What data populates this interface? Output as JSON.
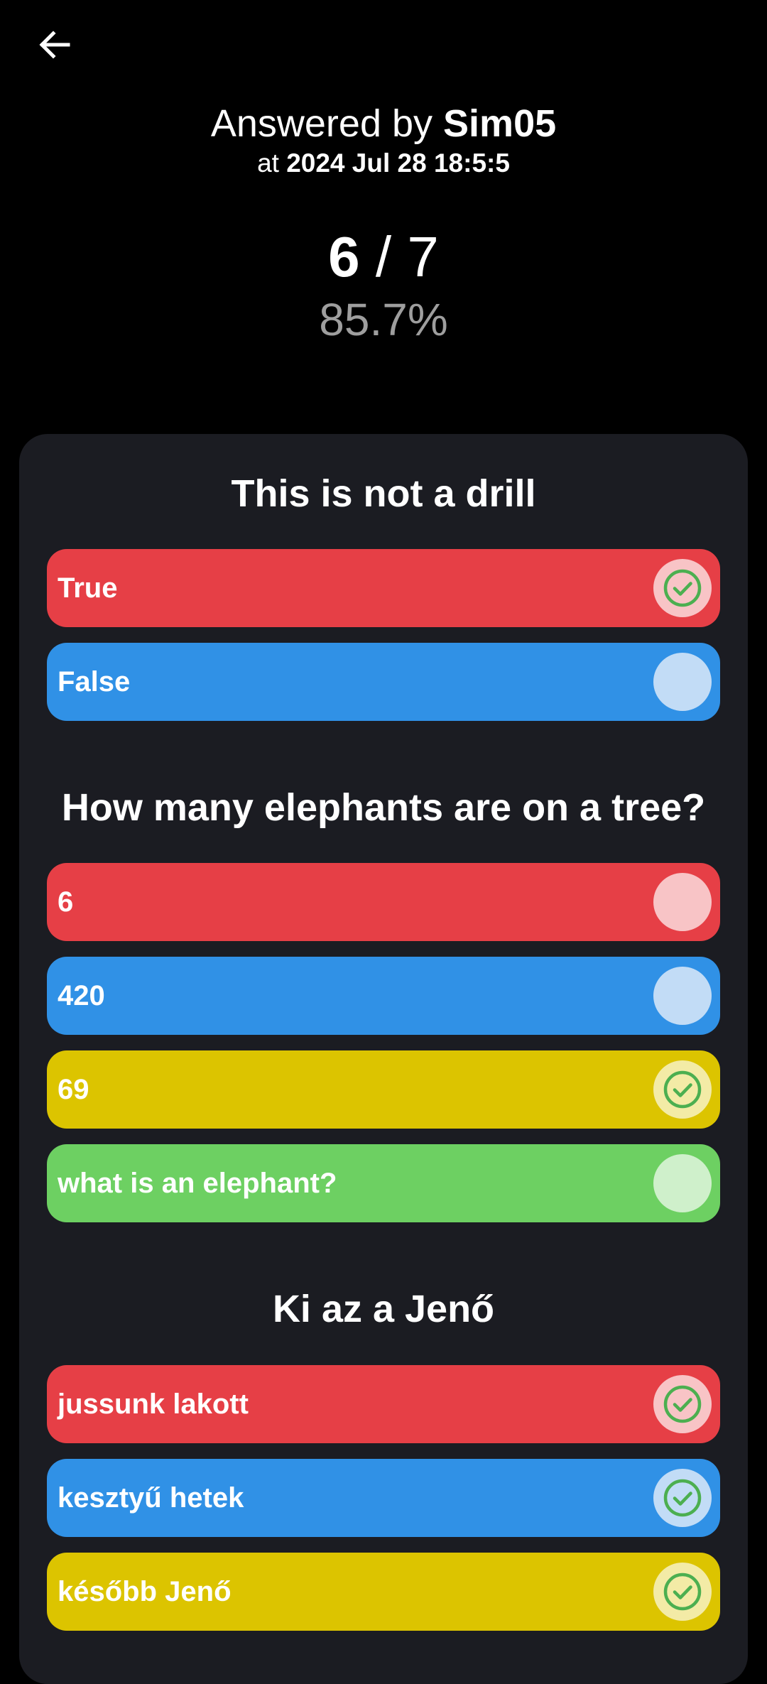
{
  "header": {
    "answered_prefix": "Answered by",
    "user": "Sim05",
    "at_prefix": "at",
    "timestamp": "2024 Jul 28 18:5:5",
    "score_correct": "6",
    "score_separator": "/",
    "score_total": "7",
    "percent": "85.7%"
  },
  "questions": [
    {
      "title": "This is not a drill",
      "answers": [
        {
          "label": "True",
          "color": "red",
          "correct": true
        },
        {
          "label": "False",
          "color": "blue",
          "correct": false
        }
      ]
    },
    {
      "title": "How many elephants are on a tree?",
      "answers": [
        {
          "label": "6",
          "color": "red",
          "correct": false
        },
        {
          "label": "420",
          "color": "blue",
          "correct": false
        },
        {
          "label": "69",
          "color": "yellow",
          "correct": true
        },
        {
          "label": "what is an elephant?",
          "color": "green",
          "correct": false
        }
      ]
    },
    {
      "title": "Ki az a Jenő",
      "answers": [
        {
          "label": "jussunk lakott",
          "color": "red",
          "correct": true
        },
        {
          "label": "kesztyű hetek",
          "color": "blue",
          "correct": true
        },
        {
          "label": "később Jenő",
          "color": "yellow",
          "correct": true
        }
      ]
    }
  ],
  "icons": {
    "back": "arrow-left-icon",
    "correct": "check-circle-icon"
  },
  "colors": {
    "background": "#000000",
    "card": "#1b1c22",
    "red": "#e63f46",
    "blue": "#3091e6",
    "yellow": "#dcc400",
    "green": "#6dd062",
    "check": "#4caf50",
    "percent_text": "#9e9e9e"
  }
}
